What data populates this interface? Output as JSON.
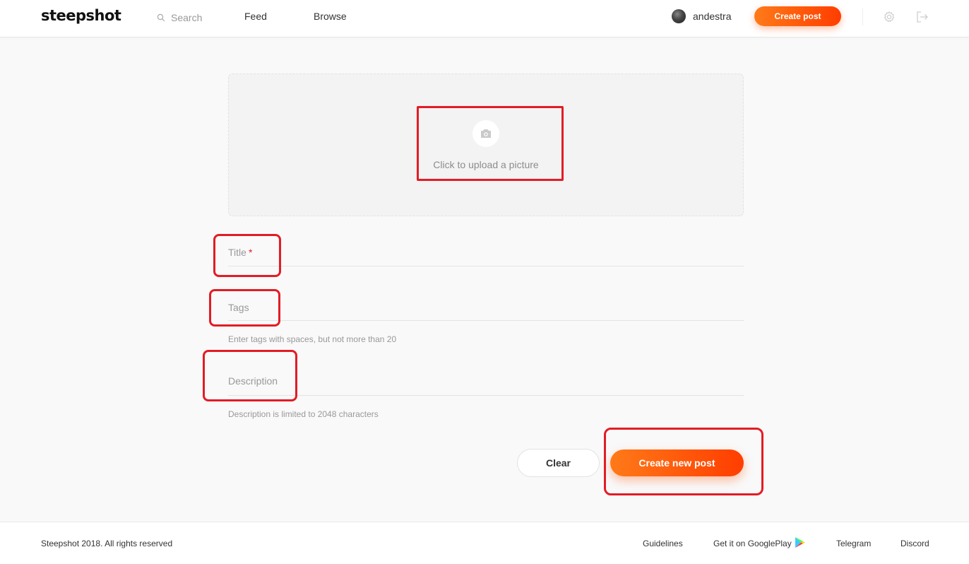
{
  "header": {
    "logo": "steepshot",
    "search_placeholder": "Search",
    "nav": {
      "feed": "Feed",
      "browse": "Browse"
    },
    "username": "andestra",
    "create_post_label": "Create post",
    "icons": {
      "search": "search-icon",
      "settings": "gear-icon",
      "logout": "logout-icon",
      "avatar": "avatar"
    }
  },
  "upload": {
    "text": "Click to upload a picture",
    "icon": "camera-icon"
  },
  "form": {
    "title_placeholder": "Title",
    "title_required_mark": "*",
    "tags_placeholder": "Tags",
    "tags_hint": "Enter tags with spaces, but not more than 20",
    "description_placeholder": "Description",
    "description_hint": "Description is limited to 2048 characters"
  },
  "actions": {
    "clear_label": "Clear",
    "create_label": "Create new post"
  },
  "footer": {
    "copyright": "Steepshot 2018. All rights reserved",
    "links": {
      "guidelines": "Guidelines",
      "googleplay": "Get it on GooglePlay",
      "telegram": "Telegram",
      "discord": "Discord"
    }
  },
  "colors": {
    "accent_start": "#ff7a18",
    "accent_end": "#ff3d00",
    "annotation": "#e31c25",
    "background": "#f9f9f9"
  }
}
